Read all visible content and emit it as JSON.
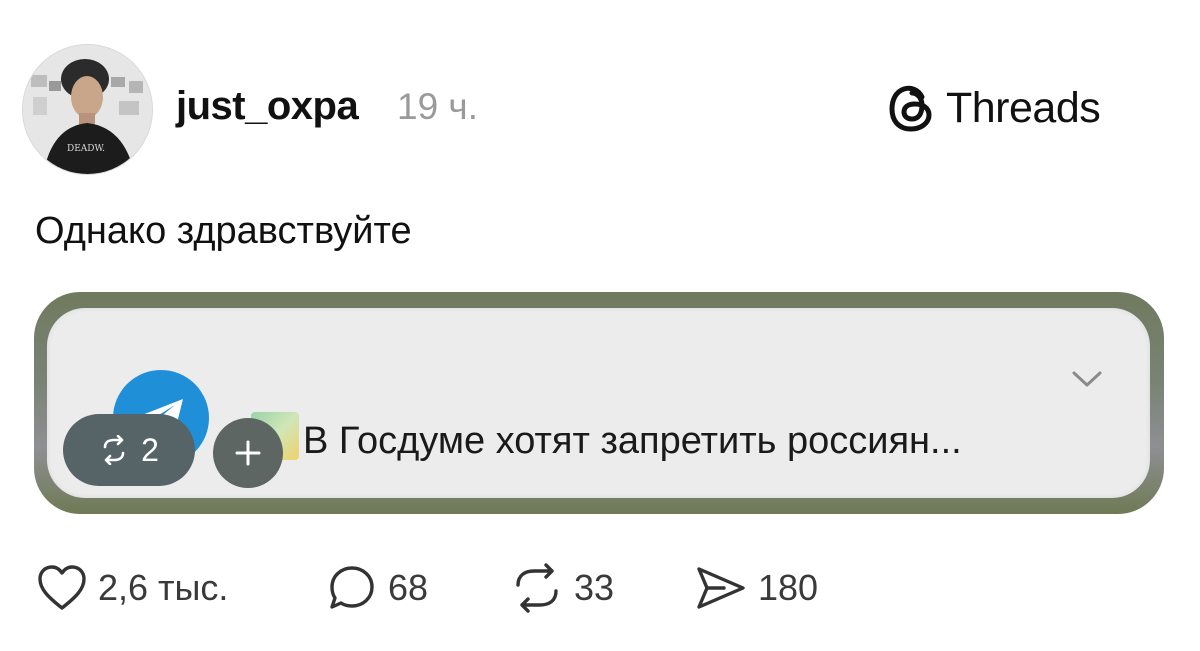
{
  "post": {
    "username": "just_oxpa",
    "time": "19 ч.",
    "brand": "Threads",
    "text": "Однако здравствуйте",
    "avatar_shirt_text": "DEADW."
  },
  "embedded": {
    "notification_text": "В Госдуме хотят запретить россиян...",
    "repost_chip_count": "2",
    "icons": [
      "telegram-icon",
      "chevron-down-icon",
      "repost-icon",
      "plus-icon"
    ]
  },
  "actions": {
    "likes": "2,6 тыс.",
    "replies": "68",
    "reposts": "33",
    "shares": "180"
  },
  "colors": {
    "telegram_blue": "#1f8fd8",
    "chip_bg": "#566467",
    "muted_text": "#9a9a9a"
  }
}
